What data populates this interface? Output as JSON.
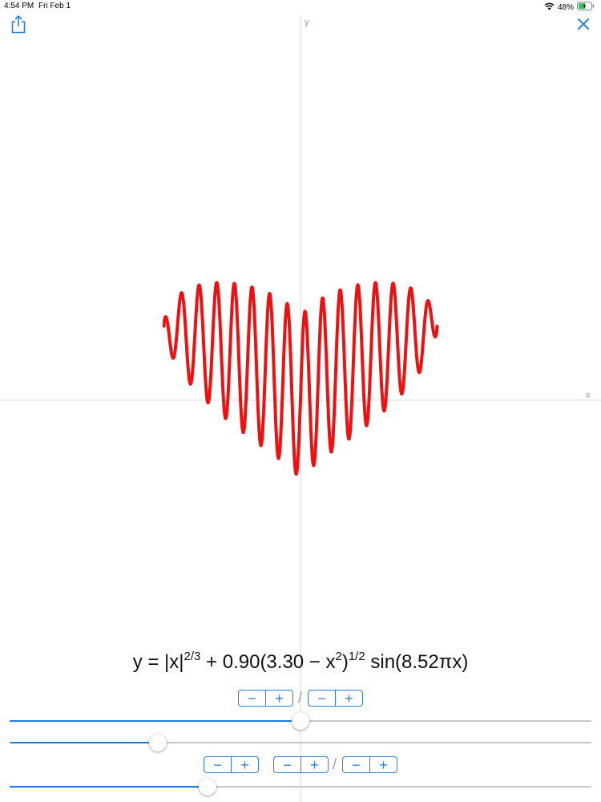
{
  "status_bar": {
    "time": "4:54 PM",
    "date": "Fri Feb 1",
    "battery": "48%",
    "icons": [
      "wifi-icon",
      "battery-charging-icon"
    ]
  },
  "toolbar": {
    "share_icon": "share-icon",
    "close_icon": "close-icon"
  },
  "graph": {
    "x_axis_label": "x",
    "y_axis_label": "y",
    "curve_color": "#ee1111",
    "axis_color": "#d8d8d8"
  },
  "equation": {
    "lhs": "y = |x|",
    "exp1": "2/3",
    "mid": " + 0.90(3.30 − x",
    "exp2": "2",
    "close": ")",
    "exp3": "1/2",
    "tail": " sin(8.52πx)"
  },
  "steppers": {
    "minus_label": "−",
    "plus_label": "+",
    "separator": "/"
  },
  "sliders": [
    {
      "name": "coefficient-slider",
      "value_fraction": 0.5
    },
    {
      "name": "constant-slider",
      "value_fraction": 0.255
    },
    {
      "name": "frequency-slider",
      "value_fraction": 0.34
    }
  ],
  "chart_data": {
    "type": "line",
    "title": "",
    "xlabel": "x",
    "ylabel": "y",
    "function": "y = |x|^(2/3) + 0.90(3.30 - x^2)^(1/2) sin(8.52πx)",
    "params": {
      "a": 0.9,
      "b": 3.3,
      "k": 8.52
    },
    "xlim": [
      -1.8166,
      1.8166
    ],
    "ylim": [
      -2.28,
      2.28
    ],
    "series": [
      {
        "color": "#ee1111"
      }
    ]
  },
  "colors": {
    "accent": "#2b7fe0",
    "slider_fill": "#1a7de0",
    "curve": "#ee1111"
  }
}
